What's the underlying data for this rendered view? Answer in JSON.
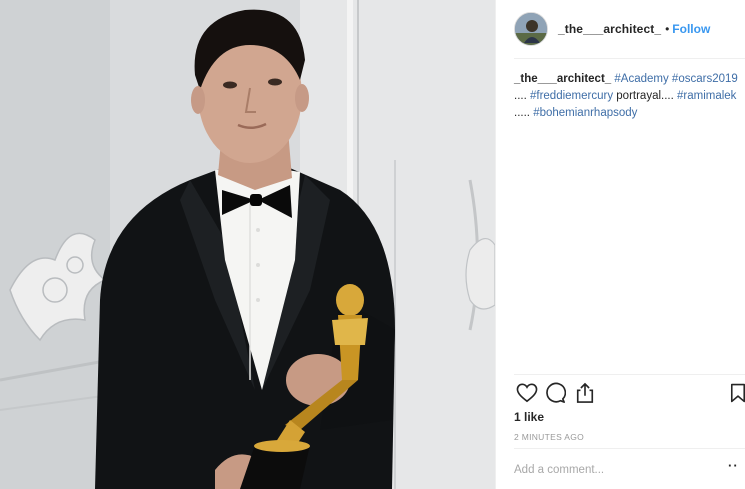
{
  "post": {
    "username": "_the___architect_",
    "separator": "•",
    "follow_label": "Follow"
  },
  "caption": {
    "username": "_the___architect_",
    "tag1": "#Academy",
    "tag2": "#oscars2019",
    "text1": " ....",
    "tag3": "#freddiemercury",
    "text2": " portrayal.... ",
    "tag4": "#ramimalek",
    "text3": " .....",
    "tag5": "#bohemianrhapsody"
  },
  "actions": {
    "icons": [
      "heart-icon",
      "comment-icon",
      "share-icon",
      "bookmark-icon"
    ]
  },
  "likes_label": "1 like",
  "timestamp": "2 MINUTES AGO",
  "comment": {
    "placeholder": "Add a comment...",
    "more_label": "··"
  },
  "colors": {
    "link": "#3897f0",
    "hashtag": "#3f6ea7",
    "muted": "#999999",
    "text": "#262626"
  }
}
